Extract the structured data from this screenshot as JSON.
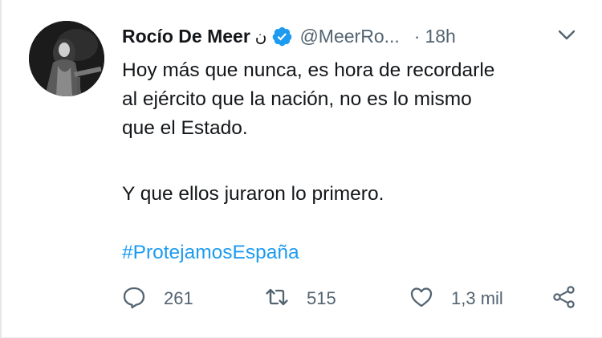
{
  "tweet": {
    "author_name": "Rocío De Meer",
    "name_extra": "ن",
    "handle": "@MeerRo...",
    "separator": "·",
    "time": "18h",
    "text_p1": "Hoy más que nunca, es hora de recordarle\nal ejército que la nación, no es lo mismo\nque el Estado.",
    "text_p2": "Y que ellos juraron lo primero.",
    "hashtag": "#ProtejamosEspaña",
    "replies": "261",
    "retweets": "515",
    "likes": "1,3 mil"
  },
  "icons": {
    "avatar": "avatar",
    "verified": "verified-badge-icon",
    "menu": "chevron-down-icon",
    "reply": "reply-icon",
    "retweet": "retweet-icon",
    "like": "heart-icon",
    "share": "share-icon"
  },
  "colors": {
    "link": "#1d9bf0",
    "verified": "#1d9bf0",
    "secondary_text": "#536471",
    "primary_text": "#14171a"
  }
}
